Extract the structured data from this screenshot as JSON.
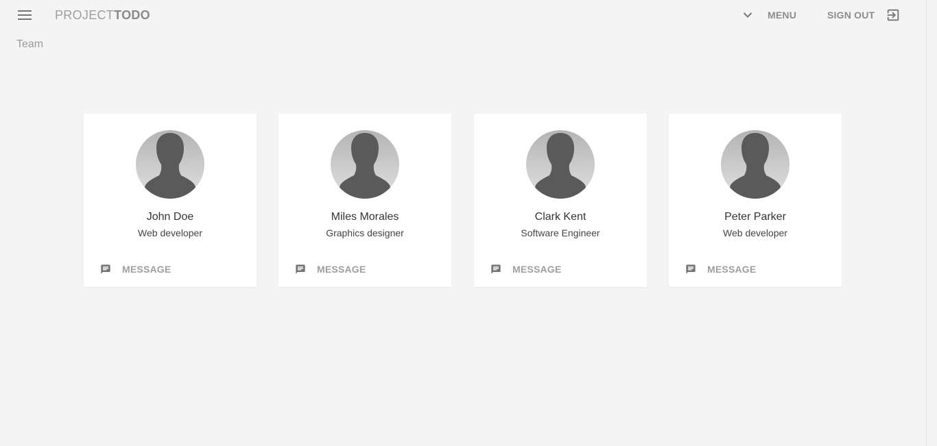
{
  "header": {
    "brand_light": "PROJECT",
    "brand_bold": "TODO",
    "menu_label": "MENU",
    "signout_label": "SIGN OUT"
  },
  "page": {
    "title": "Team"
  },
  "team": [
    {
      "name": "John Doe",
      "role": "Web developer",
      "action": "MESSAGE"
    },
    {
      "name": "Miles Morales",
      "role": "Graphics designer",
      "action": "MESSAGE"
    },
    {
      "name": "Clark Kent",
      "role": "Software Engineer",
      "action": "MESSAGE"
    },
    {
      "name": "Peter Parker",
      "role": "Web developer",
      "action": "MESSAGE"
    }
  ],
  "icons": {
    "menu": "hamburger-menu-icon",
    "dropdown": "chevron-down-icon",
    "signout": "exit-to-app-icon",
    "message": "chat-message-icon",
    "avatar": "person-silhouette-icon"
  },
  "colors": {
    "background": "#f4f4f4",
    "card": "#ffffff",
    "text_muted": "#9e9e9e",
    "avatar_fill": "#5a5a5a"
  }
}
